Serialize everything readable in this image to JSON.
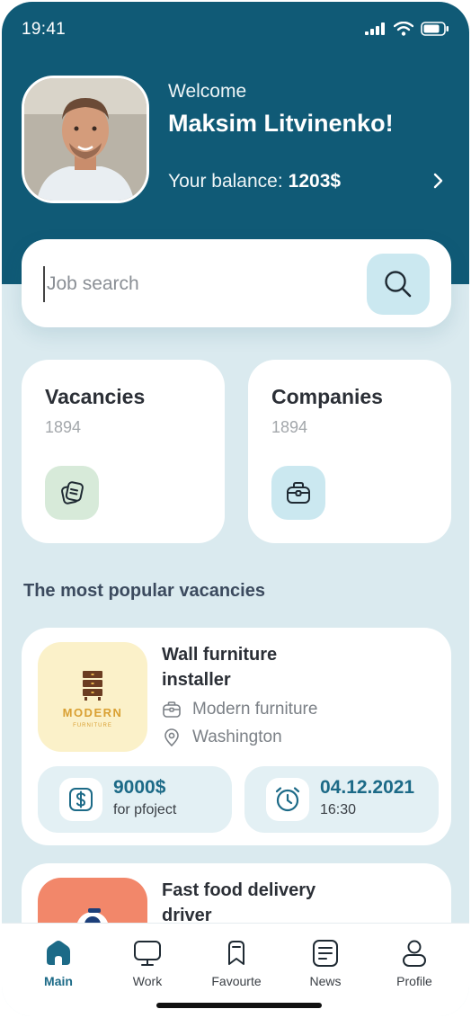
{
  "status": {
    "time": "19:41"
  },
  "profile": {
    "welcome": "Welcome",
    "name": "Maksim Litvinenko!",
    "balance_label": "Your balance:",
    "balance_value": "1203$"
  },
  "search": {
    "placeholder": "Job search",
    "value": ""
  },
  "categories": [
    {
      "title": "Vacancies",
      "count": "1894",
      "icon": "vacancies-stack-icon",
      "icon_bg": "#d7ead9"
    },
    {
      "title": "Companies",
      "count": "1894",
      "icon": "briefcase-icon",
      "icon_bg": "#cbe8f0"
    }
  ],
  "section_title": "The most popular vacancies",
  "jobs": [
    {
      "title": "Wall furniture installer",
      "company": "Modern furniture",
      "location": "Washington",
      "logo_text": "MODERN",
      "logo_subtext": "FURNITURE",
      "logo_bg": "#fbf1c9",
      "price": "9000$",
      "price_note": "for pfoject",
      "date": "04.12.2021",
      "time": "16:30"
    },
    {
      "title": "Fast food delivery driver",
      "logo_bg": "#f2876a"
    }
  ],
  "tabs": [
    {
      "label": "Main",
      "icon": "home-icon",
      "active": true
    },
    {
      "label": "Work",
      "icon": "monitor-icon",
      "active": false
    },
    {
      "label": "Favourte",
      "icon": "bookmark-icon",
      "active": false
    },
    {
      "label": "News",
      "icon": "news-icon",
      "active": false
    },
    {
      "label": "Profile",
      "icon": "profile-icon",
      "active": false
    }
  ],
  "colors": {
    "header": "#105a76",
    "background": "#daeaef",
    "accent": "#1c6a87",
    "search_button": "#cbe8f0"
  }
}
